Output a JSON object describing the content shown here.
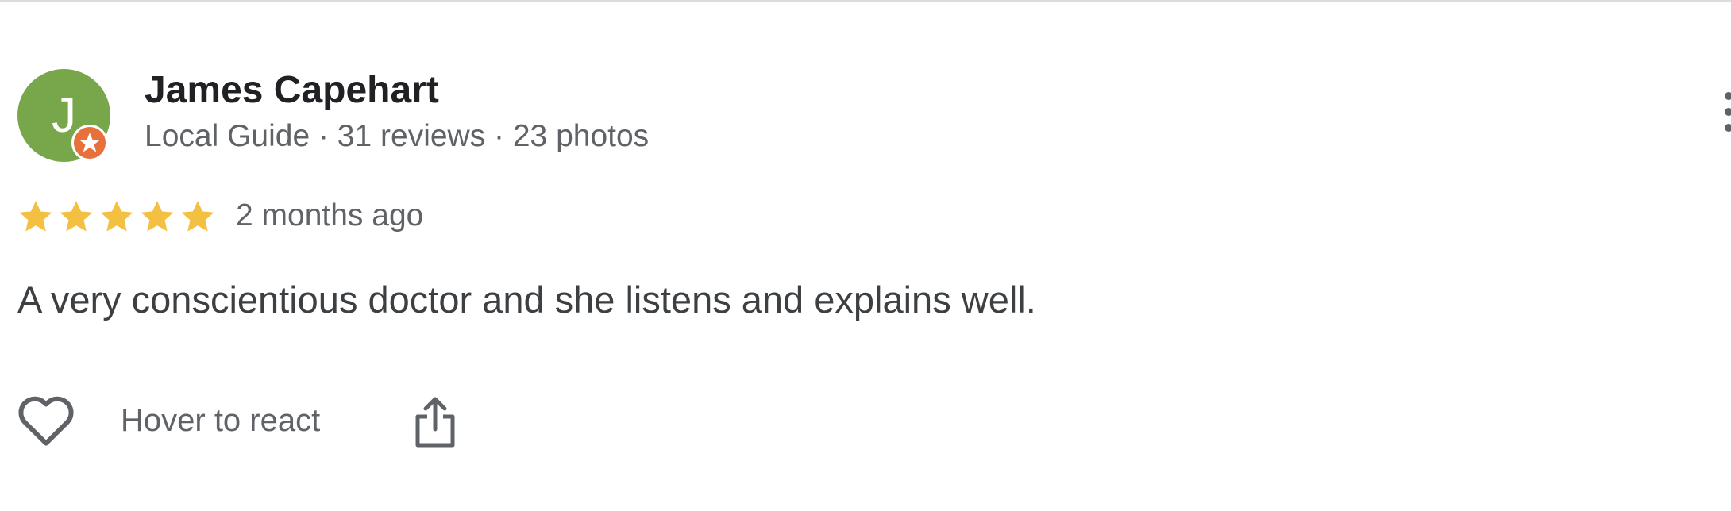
{
  "review": {
    "author": {
      "initial": "J",
      "name": "James Capehart",
      "meta": "Local Guide · 31 reviews · 23 photos",
      "avatar_color": "#78a64b",
      "badge_color": "#e8703a",
      "badge_icon": "star-icon"
    },
    "rating": {
      "value": 5,
      "max": 5,
      "star_color": "#f4c042"
    },
    "date": "2 months ago",
    "text": "A very conscientious doctor and she listens and explains well.",
    "actions": {
      "react_label": "Hover to react",
      "react_icon": "heart-outline-icon",
      "share_icon": "share-icon",
      "more_icon": "more-vertical-icon"
    }
  }
}
